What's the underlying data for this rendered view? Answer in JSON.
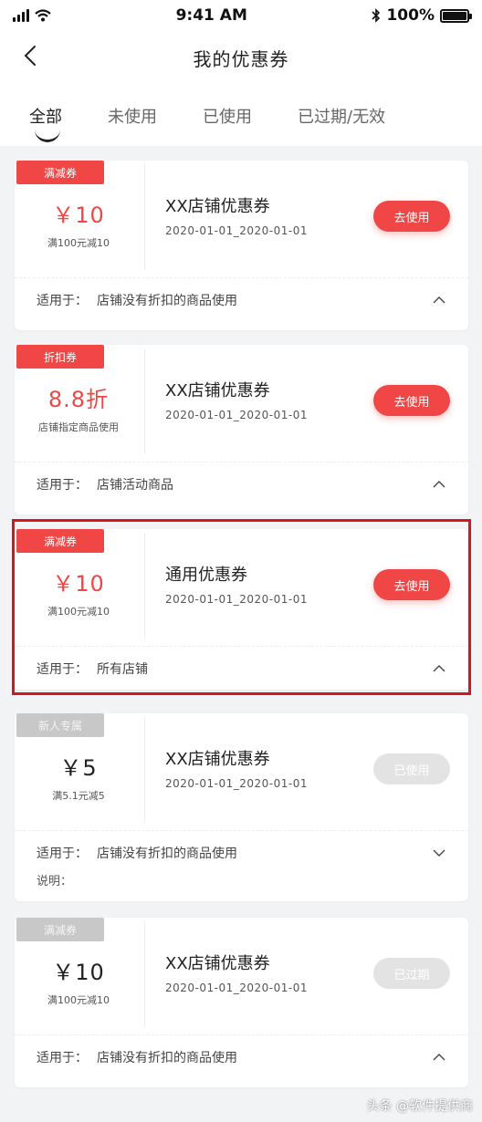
{
  "status_bar": {
    "time": "9:41 AM",
    "battery": "100%",
    "battery_level": 1.0
  },
  "nav": {
    "title": "我的优惠券"
  },
  "tabs": [
    "全部",
    "未使用",
    "已使用",
    "已过期/无效"
  ],
  "active_tab": 0,
  "coupons": [
    {
      "tag": "满减券",
      "amount": "￥10",
      "condition": "满100元减10",
      "title": "XX店铺优惠券",
      "date": "2020-01-01_2020-01-01",
      "button": "去使用",
      "apply_label": "适用于：",
      "apply_text": "店铺没有折扣的商品使用"
    },
    {
      "tag": "折扣券",
      "amount": "8.8折",
      "condition": "店铺指定商品使用",
      "title": "XX店铺优惠券",
      "date": "2020-01-01_2020-01-01",
      "button": "去使用",
      "apply_label": "适用于：",
      "apply_text": "店铺活动商品"
    },
    {
      "tag": "满减券",
      "amount": "￥10",
      "condition": "满100元减10",
      "title": "通用优惠券",
      "date": "2020-01-01_2020-01-01",
      "button": "去使用",
      "apply_label": "适用于：",
      "apply_text": "所有店铺"
    },
    {
      "tag": "新人专属",
      "amount": "￥5",
      "condition": "满5.1元减5",
      "title": "XX店铺优惠券",
      "date": "2020-01-01_2020-01-01",
      "button": "已使用",
      "apply_label": "适用于：",
      "apply_text": "店铺没有折扣的商品使用",
      "note": "说明："
    },
    {
      "tag": "满减券",
      "amount": "￥10",
      "condition": "满100元减10",
      "title": "XX店铺优惠券",
      "date": "2020-01-01_2020-01-01",
      "button": "已过期",
      "apply_label": "适用于：",
      "apply_text": "店铺没有折扣的商品使用"
    }
  ],
  "watermark": "头条 @软件提供商",
  "colors": {
    "accent": "#f04646",
    "disabled": "#e3e3e3",
    "highlight": "#d6161e",
    "background": "#f2f3f5"
  }
}
